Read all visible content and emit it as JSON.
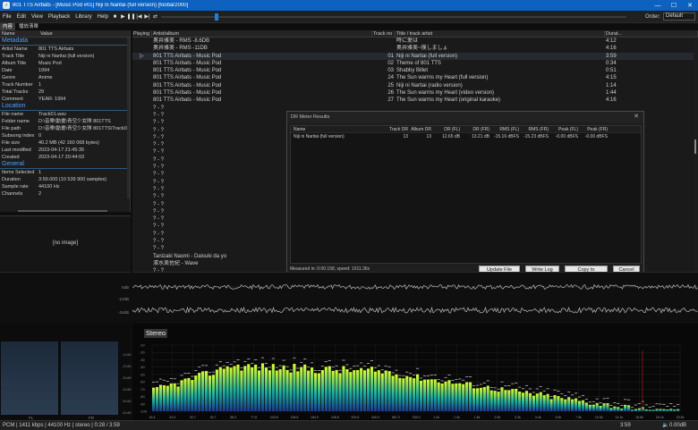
{
  "window": {
    "title": "801 TTS Airbats - [Music Pod #01] Niji ni Naritai (full version)  [foobar2000]"
  },
  "menu": [
    "File",
    "Edit",
    "View",
    "Playback",
    "Library",
    "Help"
  ],
  "order": {
    "label": "Order:",
    "value": "Default"
  },
  "tabs": [
    "内容",
    "播放清單"
  ],
  "props": {
    "headers": [
      "Name",
      "Value"
    ],
    "sections": [
      {
        "title": "Metadata",
        "rows": [
          [
            "Artist Name",
            "801 TTS Airbats"
          ],
          [
            "Track Title",
            "Niji ni Naritai (full version)"
          ],
          [
            "Album Title",
            "Music Pod"
          ],
          [
            "Date",
            "1994"
          ],
          [
            "Genre",
            "Anime"
          ],
          [
            "Track Number",
            "1"
          ],
          [
            "Total Tracks",
            "29"
          ],
          [
            "Comment",
            "YEAR: 1994"
          ]
        ]
      },
      {
        "title": "Location",
        "rows": [
          [
            "File name",
            "Track01.wav"
          ],
          [
            "Folder name",
            "D:\\音樂\\動畫\\青空少女隊 801TTS"
          ],
          [
            "File path",
            "D:\\音樂\\動畫\\青空少女隊 801TTS\\Track01.wav"
          ],
          [
            "Subsong index",
            "0"
          ],
          [
            "File size",
            "40.2 MB (42 160 068 bytes)"
          ],
          [
            "Last modified",
            "2023-04-17 21:45:35"
          ],
          [
            "Created",
            "2023-04-17 20:44:03"
          ]
        ]
      },
      {
        "title": "General",
        "rows": [
          [
            "Items Selected",
            "1"
          ],
          [
            "Duration",
            "3:59.000 (10 539 900 samples)"
          ],
          [
            "Sample rate",
            "44100 Hz"
          ],
          [
            "Channels",
            "2"
          ]
        ]
      }
    ]
  },
  "album_art": {
    "placeholder": "[no image]"
  },
  "playlist": {
    "headers": [
      "Playing",
      "Artist/album",
      "Track no",
      "Title / track artist",
      "Durat..."
    ],
    "rows": [
      [
        "",
        "奥井雅美 - RMS -8.6DB",
        "",
        "時に愛は",
        "4:12"
      ],
      [
        "",
        "奥井雅美 - RMS -11DB",
        "",
        "奥井雅美~僕しましょ",
        "4:16"
      ],
      [
        "▷",
        "801 TTS Airbats - Music Pod",
        "01",
        "Niji ni Naritai (full version)",
        "3:59"
      ],
      [
        "",
        "801 TTS Airbats - Music Pod",
        "02",
        "Theme of 801 TTS",
        "0:34"
      ],
      [
        "",
        "801 TTS Airbats - Music Pod",
        "03",
        "Shabby Billet",
        "0:51"
      ],
      [
        "",
        "801 TTS Airbats - Music Pod",
        "24",
        "The Sun warms my Heart (full version)",
        "4:15"
      ],
      [
        "",
        "801 TTS Airbats - Music Pod",
        "25",
        "Niji ni Naritai (radio version)",
        "1:14"
      ],
      [
        "",
        "801 TTS Airbats - Music Pod",
        "26",
        "The Sun warms my Heart (video version)",
        "1:44"
      ],
      [
        "",
        "801 TTS Airbats - Music Pod",
        "27",
        "The Sun warms my Heart (original karaoke)",
        "4:16"
      ],
      [
        "",
        "? - ?",
        "",
        "",
        ""
      ],
      [
        "",
        "? - ?",
        "",
        "",
        ""
      ],
      [
        "",
        "? - ?",
        "",
        "",
        ""
      ],
      [
        "",
        "? - ?",
        "",
        "",
        ""
      ],
      [
        "",
        "? - ?",
        "",
        "",
        ""
      ],
      [
        "",
        "? - ?",
        "",
        "",
        ""
      ],
      [
        "",
        "? - ?",
        "",
        "",
        ""
      ],
      [
        "",
        "? - ?",
        "",
        "",
        ""
      ],
      [
        "",
        "? - ?",
        "",
        "",
        ""
      ],
      [
        "",
        "? - ?",
        "",
        "",
        ""
      ],
      [
        "",
        "? - ?",
        "",
        "",
        ""
      ],
      [
        "",
        "? - ?",
        "",
        "",
        ""
      ],
      [
        "",
        "? - ?",
        "",
        "",
        ""
      ],
      [
        "",
        "? - ?",
        "",
        "",
        ""
      ],
      [
        "",
        "? - ?",
        "",
        "",
        ""
      ],
      [
        "",
        "? - ?",
        "",
        "",
        ""
      ],
      [
        "",
        "? - ?",
        "",
        "",
        ""
      ],
      [
        "",
        "? - ?",
        "",
        "",
        ""
      ],
      [
        "",
        "? - ?",
        "",
        "",
        ""
      ],
      [
        "",
        "? - ?",
        "",
        "",
        ""
      ],
      [
        "",
        "Tanizaki Naomi - Daisuki da yo",
        "",
        "",
        ""
      ],
      [
        "",
        "濱水美佐紀 - Wave",
        "",
        "",
        ""
      ],
      [
        "",
        "? - ?",
        "",
        "",
        ""
      ]
    ]
  },
  "dr_dialog": {
    "title": "DR Meter Results",
    "headers": [
      "Name",
      "Track DR",
      "Album DR",
      "DR (FL)",
      "DR (FR)",
      "RMS (FL)",
      "RMS (FR)",
      "Peak (FL)",
      "Peak (FR)"
    ],
    "row": [
      "Niji ni Naritai (full version)",
      "13",
      "13",
      "12.65 dB",
      "13.21 dB",
      "-15.16 dBFS",
      "-15.23 dBFS",
      "-0.00 dBFS",
      "-0.00 dBFS"
    ],
    "measured": "Measured in: 0:00.158, speed: 1511.36x",
    "buttons": [
      "Update File Tags",
      "Write Log",
      "Copy to clipboard",
      "Cancel"
    ]
  },
  "waveform": {
    "labels": [
      "0dB",
      "-12dB",
      "-24dB"
    ]
  },
  "vu": {
    "labels": [
      "FL",
      "FR"
    ],
    "ticks": [
      "-10dB",
      "-20dB",
      "-30dB",
      "-40dB",
      "-50dB",
      "-60dB"
    ]
  },
  "spectrum": {
    "mode": "Stereo",
    "freq_labels": [
      "16.4",
      "24.5",
      "32.7",
      "43.7",
      "58.3",
      "77.8",
      "103.8",
      "138.6",
      "184.9",
      "246.8",
      "329.6",
      "440.0",
      "587.3",
      "783.9",
      "1.0k",
      "1.4k",
      "1.8k",
      "2.5k",
      "3.3k",
      "4.4k",
      "5.9k",
      "7.9k",
      "10.5k",
      "14.1k",
      "18.8k",
      "25.1k",
      "33.5k"
    ],
    "db_labels": [
      "-10",
      "-20",
      "-30",
      "-40",
      "-50",
      "-60",
      "-70",
      "-80",
      "-90",
      "-100"
    ]
  },
  "status": {
    "left": "PCM | 1411 kbps | 44100 Hz | stereo | 0:28 / 3:59",
    "time": "3:59",
    "volume": "0.00dB"
  }
}
